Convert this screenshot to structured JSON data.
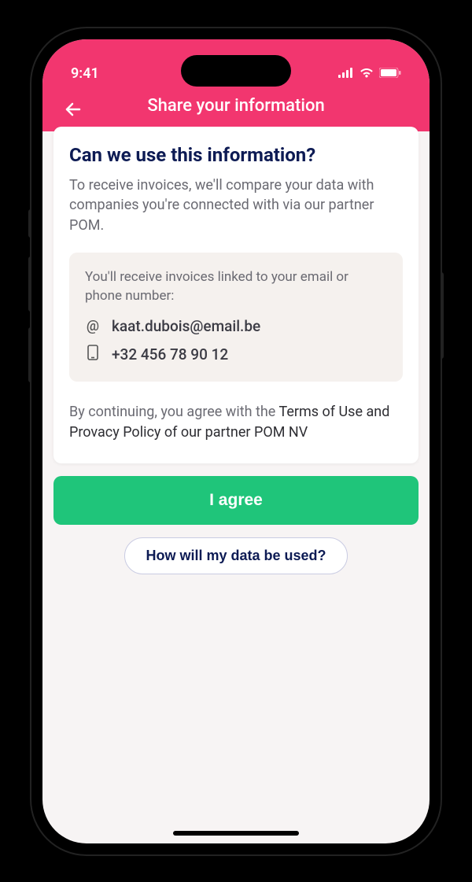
{
  "status": {
    "time": "9:41"
  },
  "header": {
    "title": "Share your information"
  },
  "card": {
    "heading": "Can we use this information?",
    "description": "To receive invoices, we'll compare your data with companies you're connected with via our partner POM.",
    "info": {
      "text": "You'll receive invoices linked to your email or phone number:",
      "email": "kaat.dubois@email.be",
      "phone": "+32 456 78 90 12"
    },
    "consent_prefix": "By continuing, you agree with the ",
    "consent_link": "Terms of Use and Provacy Policy of our partner POM NV"
  },
  "actions": {
    "agree": "I agree",
    "info": "How will my data be used?"
  }
}
